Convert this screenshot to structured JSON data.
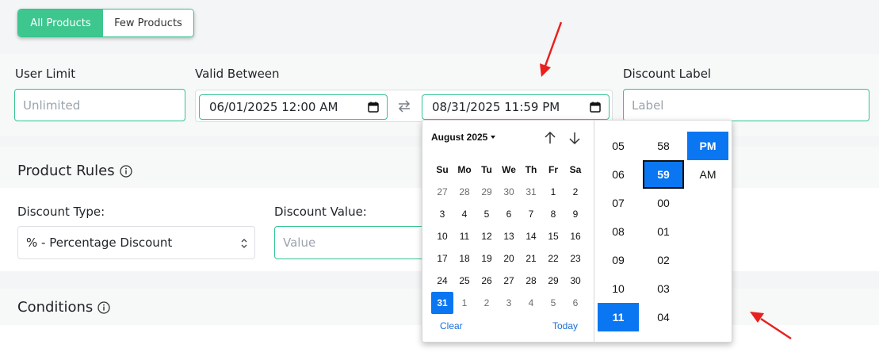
{
  "toggle": {
    "all_products": "All Products",
    "few_products": "Few Products"
  },
  "fields": {
    "user_limit": {
      "label": "User Limit",
      "placeholder": "Unlimited"
    },
    "valid_between": {
      "label": "Valid Between",
      "start": "06/01/2025 12:00 AM",
      "end": "08/31/2025 11:59 PM"
    },
    "discount_label": {
      "label": "Discount Label",
      "placeholder": "Label"
    }
  },
  "product_rules": {
    "title": "Product Rules",
    "discount_type": {
      "label": "Discount Type:",
      "value": "% - Percentage Discount"
    },
    "discount_value": {
      "label": "Discount Value:",
      "placeholder": "Value"
    }
  },
  "conditions": {
    "title": "Conditions"
  },
  "picker": {
    "month": "August 2025",
    "weekdays": [
      "Su",
      "Mo",
      "Tu",
      "We",
      "Th",
      "Fr",
      "Sa"
    ],
    "days": [
      {
        "d": "27",
        "muted": true
      },
      {
        "d": "28",
        "muted": true
      },
      {
        "d": "29",
        "muted": true
      },
      {
        "d": "30",
        "muted": true
      },
      {
        "d": "31",
        "muted": true
      },
      {
        "d": "1"
      },
      {
        "d": "2"
      },
      {
        "d": "3"
      },
      {
        "d": "4"
      },
      {
        "d": "5"
      },
      {
        "d": "6"
      },
      {
        "d": "7"
      },
      {
        "d": "8"
      },
      {
        "d": "9"
      },
      {
        "d": "10"
      },
      {
        "d": "11"
      },
      {
        "d": "12"
      },
      {
        "d": "13"
      },
      {
        "d": "14"
      },
      {
        "d": "15"
      },
      {
        "d": "16"
      },
      {
        "d": "17"
      },
      {
        "d": "18"
      },
      {
        "d": "19"
      },
      {
        "d": "20"
      },
      {
        "d": "21"
      },
      {
        "d": "22"
      },
      {
        "d": "23"
      },
      {
        "d": "24"
      },
      {
        "d": "25"
      },
      {
        "d": "26"
      },
      {
        "d": "27"
      },
      {
        "d": "28"
      },
      {
        "d": "29"
      },
      {
        "d": "30"
      },
      {
        "d": "31",
        "selected": true
      },
      {
        "d": "1",
        "muted": true
      },
      {
        "d": "2",
        "muted": true
      },
      {
        "d": "3",
        "muted": true
      },
      {
        "d": "4",
        "muted": true
      },
      {
        "d": "5",
        "muted": true
      },
      {
        "d": "6",
        "muted": true
      }
    ],
    "clear": "Clear",
    "today": "Today",
    "hours": [
      "05",
      "06",
      "07",
      "08",
      "09",
      "10",
      "11"
    ],
    "selected_hour": "11",
    "minutes": [
      "58",
      "59",
      "00",
      "01",
      "02",
      "03",
      "04"
    ],
    "selected_minute": "59",
    "ampm": [
      "PM",
      "AM"
    ],
    "selected_ampm": "PM"
  },
  "colors": {
    "accent_green": "#3ec68f",
    "select_blue": "#0a76f1",
    "annotation_red": "#e8201f"
  },
  "icons": {
    "calendar": "calendar-icon",
    "swap": "swap-arrows-icon",
    "info": "info-circle-icon",
    "up": "arrow-up-icon",
    "down": "arrow-down-icon"
  }
}
